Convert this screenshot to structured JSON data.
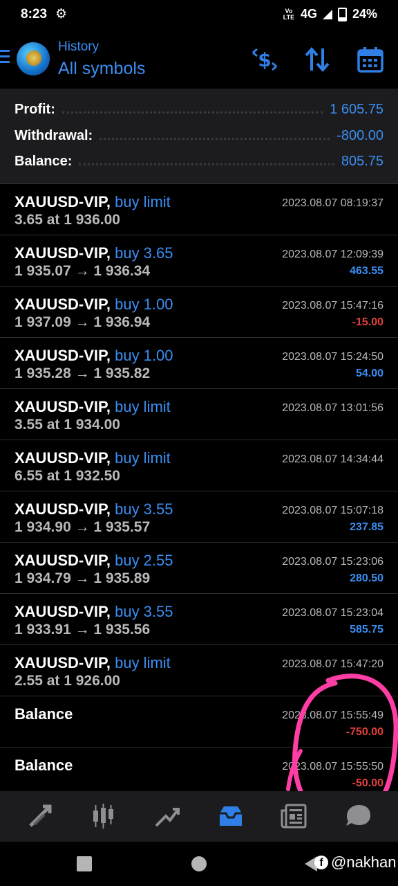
{
  "status_bar": {
    "time": "8:23",
    "network": "4G",
    "battery": "24%",
    "volte": "Vo LTE"
  },
  "app_bar": {
    "subtitle": "History",
    "title": "All symbols"
  },
  "summary": {
    "profit_label": "Profit:",
    "profit_value": "1 605.75",
    "withdrawal_label": "Withdrawal:",
    "withdrawal_value": "-800.00",
    "balance_label": "Balance:",
    "balance_value": "805.75"
  },
  "rows": [
    {
      "symbol": "XAUUSD-VIP,",
      "type": "buy limit",
      "detail": "3.65 at 1 936.00",
      "date": "2023.08.07 08:19:37",
      "amount": ""
    },
    {
      "symbol": "XAUUSD-VIP,",
      "type": "buy 3.65",
      "detail": "1 935.07 → 1 936.34",
      "date": "2023.08.07 12:09:39",
      "amount": "463.55"
    },
    {
      "symbol": "XAUUSD-VIP,",
      "type": "buy 1.00",
      "detail": "1 937.09 → 1 936.94",
      "date": "2023.08.07 15:47:16",
      "amount": "-15.00"
    },
    {
      "symbol": "XAUUSD-VIP,",
      "type": "buy 1.00",
      "detail": "1 935.28 → 1 935.82",
      "date": "2023.08.07 15:24:50",
      "amount": "54.00"
    },
    {
      "symbol": "XAUUSD-VIP,",
      "type": "buy limit",
      "detail": "3.55 at 1 934.00",
      "date": "2023.08.07 13:01:56",
      "amount": ""
    },
    {
      "symbol": "XAUUSD-VIP,",
      "type": "buy limit",
      "detail": "6.55 at 1 932.50",
      "date": "2023.08.07 14:34:44",
      "amount": ""
    },
    {
      "symbol": "XAUUSD-VIP,",
      "type": "buy 3.55",
      "detail": "1 934.90 → 1 935.57",
      "date": "2023.08.07 15:07:18",
      "amount": "237.85"
    },
    {
      "symbol": "XAUUSD-VIP,",
      "type": "buy 2.55",
      "detail": "1 934.79 → 1 935.89",
      "date": "2023.08.07 15:23:06",
      "amount": "280.50"
    },
    {
      "symbol": "XAUUSD-VIP,",
      "type": "buy 3.55",
      "detail": "1 933.91 → 1 935.56",
      "date": "2023.08.07 15:23:04",
      "amount": "585.75"
    },
    {
      "symbol": "XAUUSD-VIP,",
      "type": "buy limit",
      "detail": "2.55 at 1 926.00",
      "date": "2023.08.07 15:47:20",
      "amount": ""
    },
    {
      "symbol": "Balance",
      "type": "",
      "detail": "",
      "date": "2023.08.07 15:55:49",
      "amount": "-750.00"
    },
    {
      "symbol": "Balance",
      "type": "",
      "detail": "",
      "date": "2023.08.07 15:55:50",
      "amount": "-50.00"
    }
  ],
  "watermark": "@nakhan",
  "colors": {
    "accent": "#3a8ef2",
    "negative": "#e0413b",
    "background": "#000000",
    "panel": "#1c1c1e",
    "annotation": "#ff3ea5"
  },
  "icons": [
    "gear-icon",
    "menu-icon",
    "app-logo",
    "currency-switch-icon",
    "sort-icon",
    "calendar-icon",
    "quotes-icon",
    "chart-icon",
    "trade-icon",
    "history-icon",
    "news-icon",
    "chat-icon"
  ]
}
